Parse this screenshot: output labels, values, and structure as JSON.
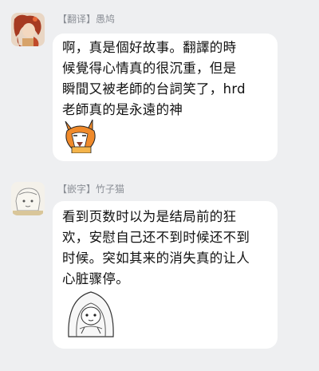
{
  "messages": [
    {
      "sender_tag": "【翻译】",
      "sender_name": "愚鸠",
      "text_lines": [
        "啊，真是個好故事。翻譯的時",
        "候覺得心情真的很沉重，但是",
        "瞬間又被老師的台詞笑了，hrd",
        "老師真的是永遠的神"
      ],
      "avatar_icon": "anime-character-avatar",
      "sticker_icon": "fox-sticker"
    },
    {
      "sender_tag": "【嵌字】",
      "sender_name": "竹子猫",
      "text_lines": [
        "看到页数时以为是结局前的狂",
        "欢，安慰自己还不到时候还不到",
        "时候。突如其来的消失真的让人",
        "心脏骤停。"
      ],
      "avatar_icon": "sketch-character-avatar",
      "sticker_icon": "hooded-figure-sticker"
    }
  ]
}
